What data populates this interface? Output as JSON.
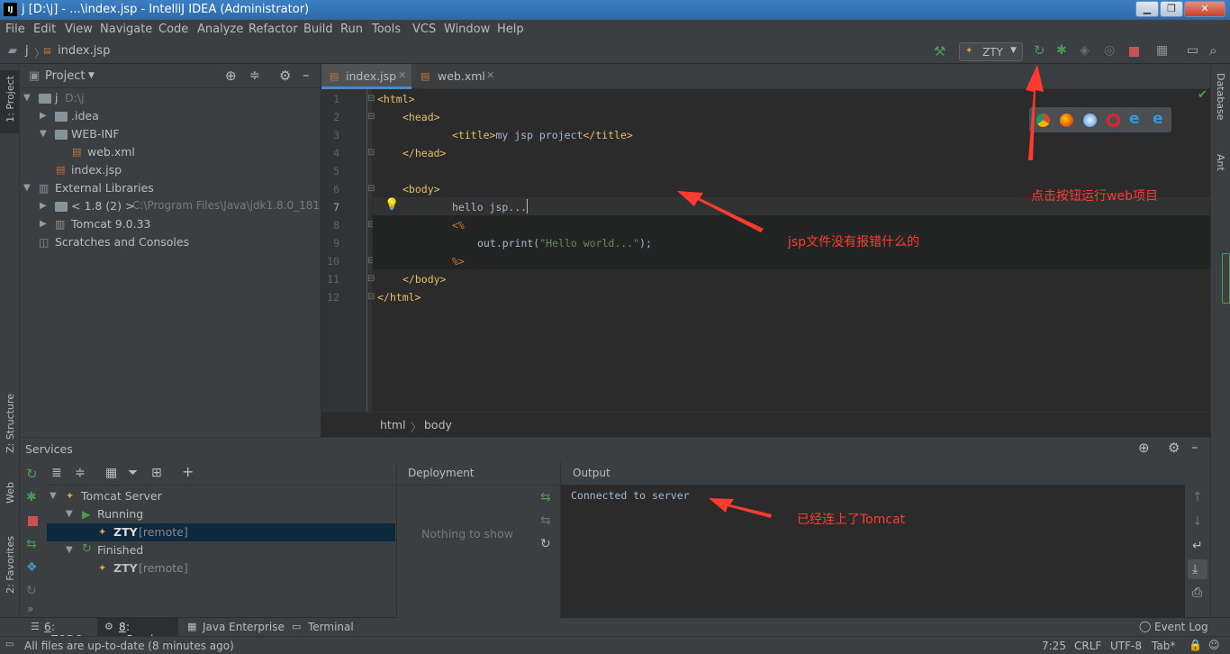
{
  "window": {
    "title": "j [D:\\j] - ...\\index.jsp - IntelliJ IDEA (Administrator)",
    "app_badge": "IJ"
  },
  "menu": [
    "File",
    "Edit",
    "View",
    "Navigate",
    "Code",
    "Analyze",
    "Refactor",
    "Build",
    "Run",
    "Tools",
    "VCS",
    "Window",
    "Help"
  ],
  "nav": {
    "project": "j",
    "file": "index.jsp",
    "run_config": "ZTY"
  },
  "left_tool_windows": {
    "project": "1: Project",
    "structure": "Z: Structure",
    "web": "Web",
    "favorites": "2: Favorites"
  },
  "right_tool_windows": {
    "database": "Database",
    "ant": "Ant"
  },
  "project_panel": {
    "title": "Project",
    "tree": [
      {
        "label": "j",
        "hint": "D:\\j"
      },
      {
        "label": ".idea"
      },
      {
        "label": "WEB-INF"
      },
      {
        "label": "web.xml"
      },
      {
        "label": "index.jsp"
      },
      {
        "label": "External Libraries"
      },
      {
        "label": "< 1.8 (2) >",
        "hint": "C:\\Program Files\\Java\\jdk1.8.0_181"
      },
      {
        "label": "Tomcat 9.0.33"
      },
      {
        "label": "Scratches and Consoles"
      }
    ]
  },
  "editor": {
    "tabs": [
      {
        "label": "index.jsp",
        "active": true
      },
      {
        "label": "web.xml",
        "active": false
      }
    ],
    "line_numbers": [
      "1",
      "2",
      "3",
      "4",
      "5",
      "6",
      "7",
      "8",
      "9",
      "10",
      "11",
      "12"
    ],
    "lines": {
      "l1": "<html>",
      "l2": "<head>",
      "l3a": "<title>",
      "l3b": "my jsp project",
      "l3c": "</title>",
      "l4": "</head>",
      "l6": "<body>",
      "l7": "hello jsp...",
      "l8": "<%",
      "l9a": "out.print(",
      "l9b": "\"Hello world...\"",
      "l9c": ");",
      "l10": "%>",
      "l11": "</body>",
      "l12": "</html>"
    },
    "breadcrumb": [
      "html",
      "body"
    ]
  },
  "services": {
    "title": "Services",
    "tree": {
      "server": "Tomcat Server",
      "running": "Running",
      "finished": "Finished",
      "config": "ZTY",
      "remote": "[remote]"
    },
    "deployment_header": "Deployment",
    "deployment_empty": "Nothing to show",
    "output_header": "Output",
    "output_text": "Connected to server"
  },
  "bottom_tabs": [
    {
      "num": "6",
      "label": ": TODO"
    },
    {
      "num": "8",
      "label": ": Services"
    },
    {
      "num": "",
      "label": "Java Enterprise"
    },
    {
      "num": "",
      "label": "Terminal"
    }
  ],
  "event_log": "Event Log",
  "status": {
    "message": "All files are up-to-date (8 minutes ago)",
    "position": "7:25",
    "line_sep": "CRLF",
    "encoding": "UTF-8",
    "indent": "Tab*"
  },
  "annotations": {
    "run": "点击按钮运行web项目",
    "jsp": "jsp文件没有报错什么的",
    "tomcat": "已经连上了Tomcat"
  },
  "colors": {
    "accent": "#4a88c7",
    "tag": "#e8bf6a",
    "string": "#6a8759",
    "jsp": "#cc7832",
    "annotation": "#ff3b30",
    "run_green": "#499c54"
  }
}
